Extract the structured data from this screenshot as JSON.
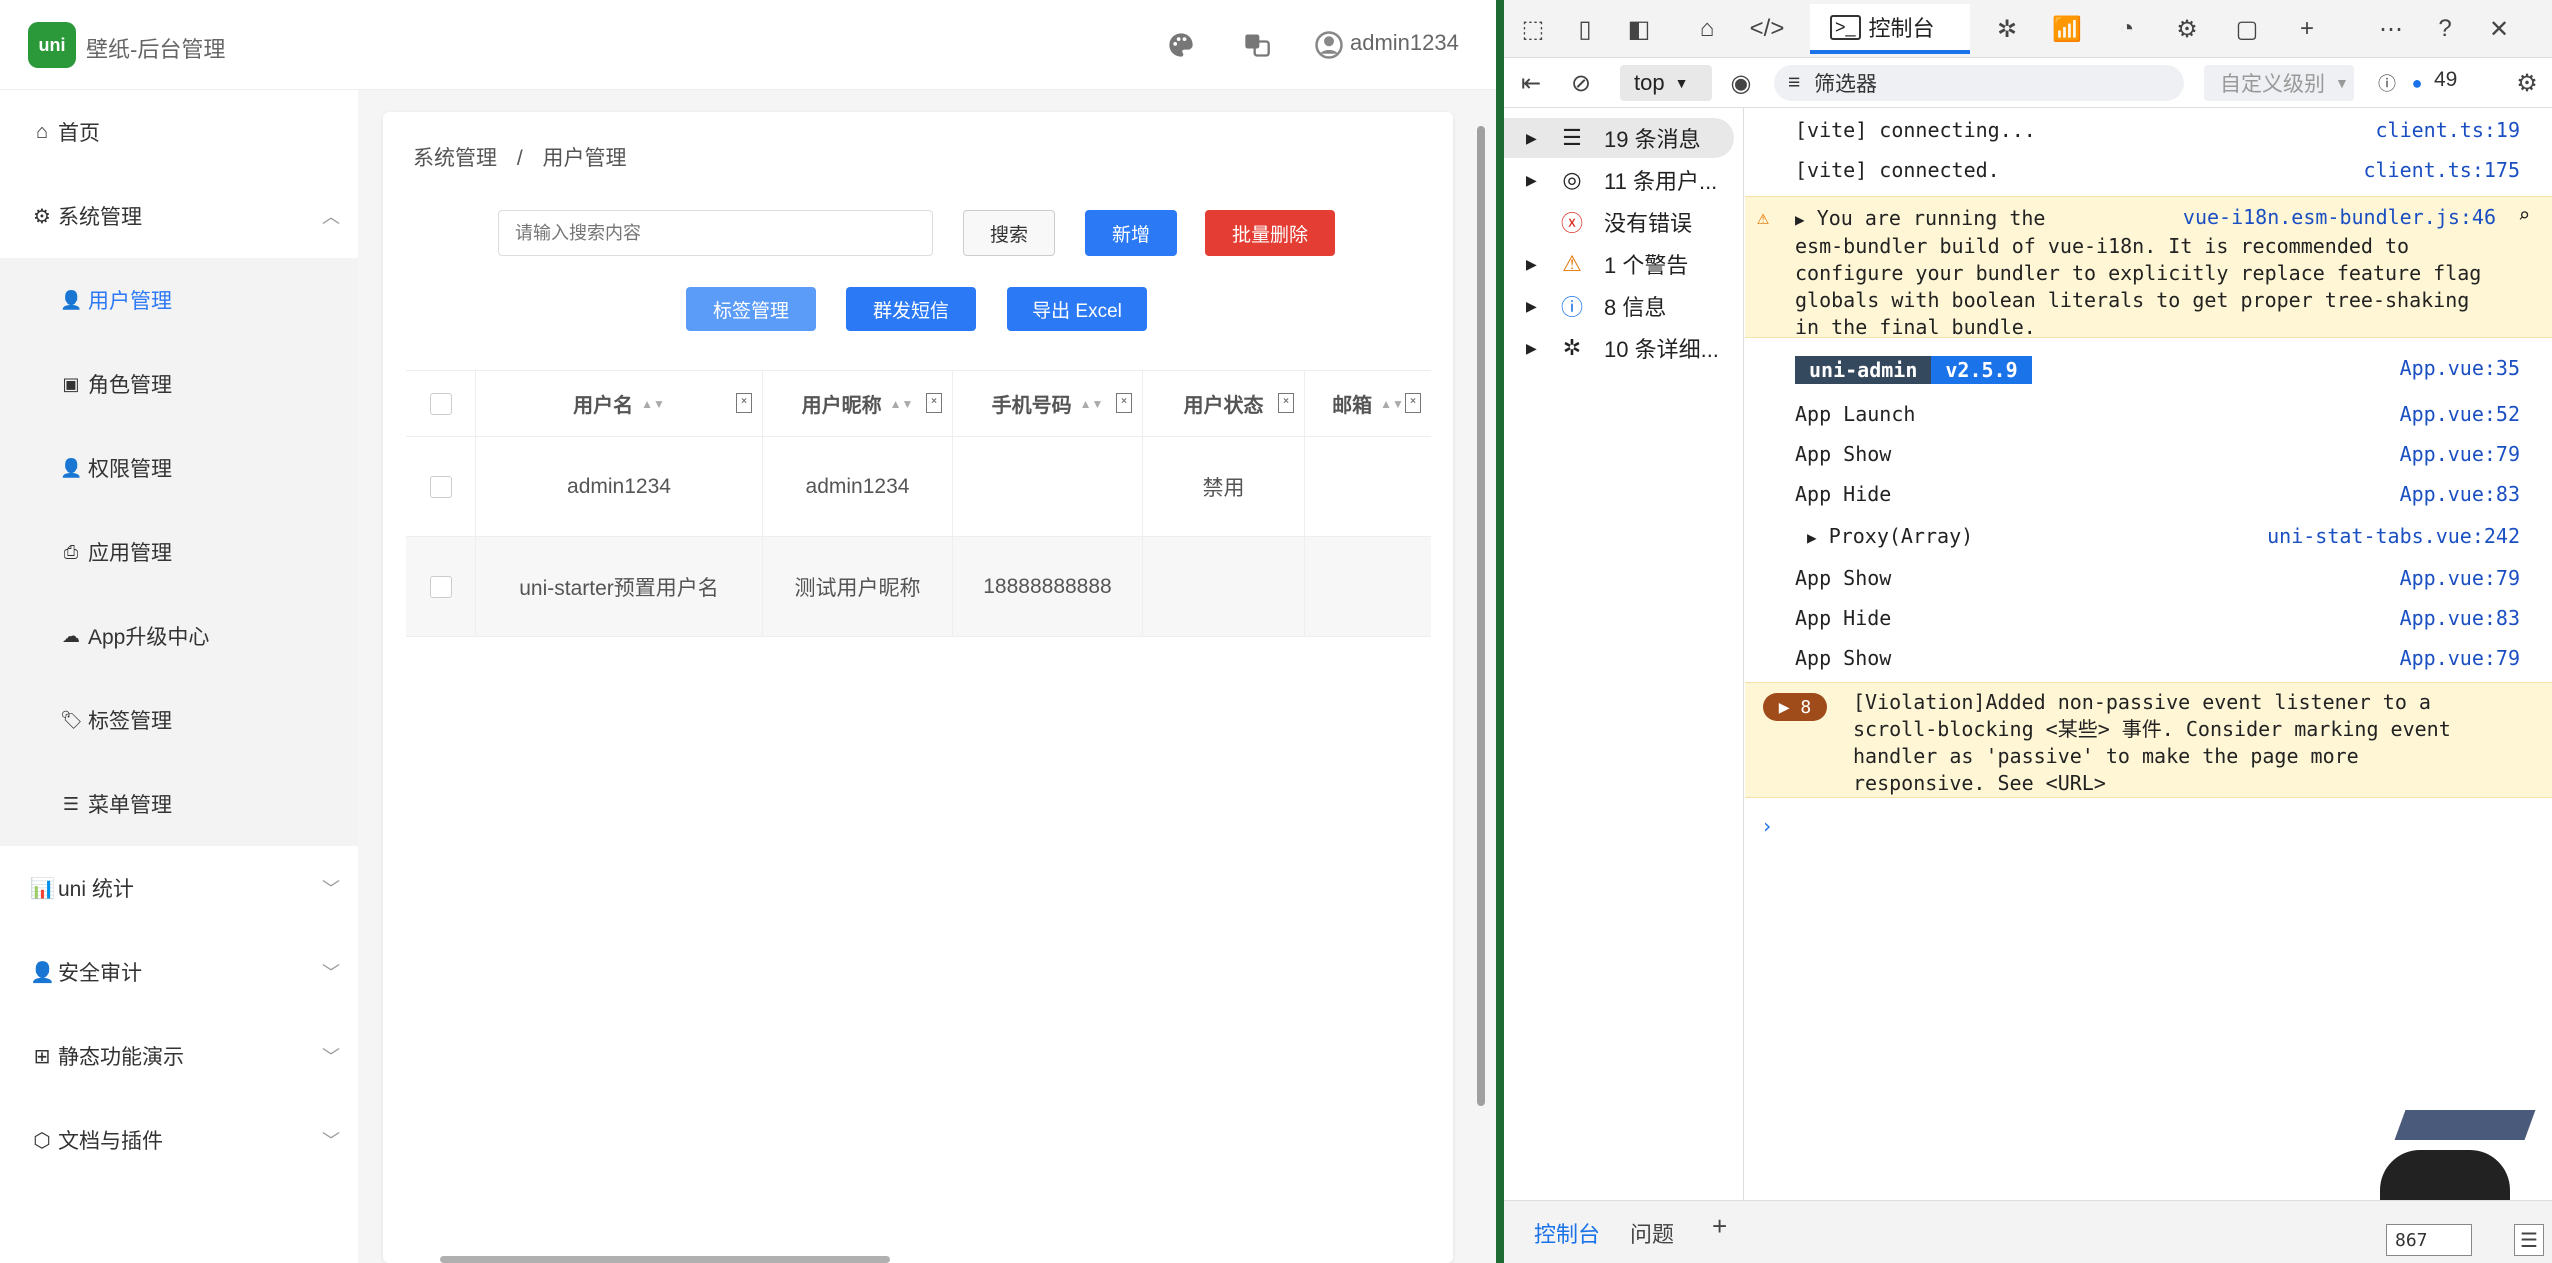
{
  "app": {
    "title": "壁纸-后台管理",
    "logo_text": "uni",
    "user": "admin1234"
  },
  "sidebar": {
    "items": [
      {
        "label": "首页",
        "icon": "home-icon"
      },
      {
        "label": "系统管理",
        "icon": "gear-icon",
        "expanded": true
      },
      {
        "label": "uni 统计",
        "icon": "chart-icon"
      },
      {
        "label": "安全审计",
        "icon": "user-icon"
      },
      {
        "label": "静态功能演示",
        "icon": "grid-icon"
      },
      {
        "label": "文档与插件",
        "icon": "plugin-icon"
      }
    ],
    "sub_items": [
      {
        "label": "用户管理",
        "icon": "user-gear-icon",
        "active": true
      },
      {
        "label": "角色管理",
        "icon": "role-icon"
      },
      {
        "label": "权限管理",
        "icon": "key-user-icon"
      },
      {
        "label": "应用管理",
        "icon": "printer-icon"
      },
      {
        "label": "App升级中心",
        "icon": "cloud-upload-icon"
      },
      {
        "label": "标签管理",
        "icon": "tag-icon"
      },
      {
        "label": "菜单管理",
        "icon": "list-icon"
      }
    ]
  },
  "content": {
    "breadcrumb": [
      "系统管理",
      "/",
      "用户管理"
    ],
    "search_placeholder": "请输入搜索内容",
    "buttons": {
      "search": "搜索",
      "add": "新增",
      "batch_delete": "批量删除",
      "tag_manage": "标签管理",
      "send_sms": "群发短信",
      "export_excel": "导出 Excel"
    },
    "table": {
      "columns": [
        "用户名",
        "用户昵称",
        "手机号码",
        "用户状态",
        "邮箱"
      ],
      "rows": [
        {
          "username": "admin1234",
          "nickname": "admin1234",
          "phone": "",
          "status": "禁用",
          "email": ""
        },
        {
          "username": "uni-starter预置用户名",
          "nickname": "测试用户昵称",
          "phone": "18888888888",
          "status": "",
          "email": ""
        }
      ]
    }
  },
  "devtools": {
    "console_tab": "控制台",
    "top_select": "top",
    "filter_placeholder": "筛选器",
    "level_select": "自定义级别",
    "message_count": "49",
    "sidebar": [
      {
        "label": "19 条消息",
        "icon": "list-icon",
        "selected": true
      },
      {
        "label": "11 条用户...",
        "icon": "user-circle-icon"
      },
      {
        "label": "没有错误",
        "icon": "error-icon"
      },
      {
        "label": "1 个警告",
        "icon": "warning-icon"
      },
      {
        "label": "8 信息",
        "icon": "info-icon"
      },
      {
        "label": "10 条详细...",
        "icon": "bug-icon"
      }
    ],
    "logs": {
      "l1": {
        "msg": "[vite] connecting...",
        "src": "client.ts:19"
      },
      "l2": {
        "msg": "[vite] connected.",
        "src": "client.ts:175"
      },
      "warn": {
        "src": "vue-i18n.esm-bundler.js:46",
        "line1": "You are running the",
        "line2": "esm-bundler build of vue-i18n. It is recommended to",
        "line3": "configure your bundler to explicitly replace feature flag",
        "line4": "globals with boolean literals to get proper tree-shaking",
        "line5": "in the final bundle."
      },
      "tag1": "uni-admin",
      "tag2": "v2.5.9",
      "tag_src": "App.vue:35",
      "a1": {
        "msg": "App Launch",
        "src": "App.vue:52"
      },
      "a2": {
        "msg": "App Show",
        "src": "App.vue:79"
      },
      "a3": {
        "msg": "App Hide",
        "src": "App.vue:83"
      },
      "proxy": {
        "msg": "Proxy(Array)",
        "src": "uni-stat-tabs.vue:242"
      },
      "a4": {
        "msg": "App Show",
        "src": "App.vue:79"
      },
      "a5": {
        "msg": "App Hide",
        "src": "App.vue:83"
      },
      "a6": {
        "msg": "App Show",
        "src": "App.vue:79"
      },
      "violation": {
        "count": "8",
        "line1": "[Violation]Added non-passive event listener to a",
        "line2": "scroll-blocking <某些> 事件. Consider marking event",
        "line3": "handler as 'passive' to make the page more",
        "line4": "responsive. See <URL>"
      }
    },
    "bottom_tabs": [
      "控制台",
      "问题"
    ],
    "pet_number": "867"
  }
}
